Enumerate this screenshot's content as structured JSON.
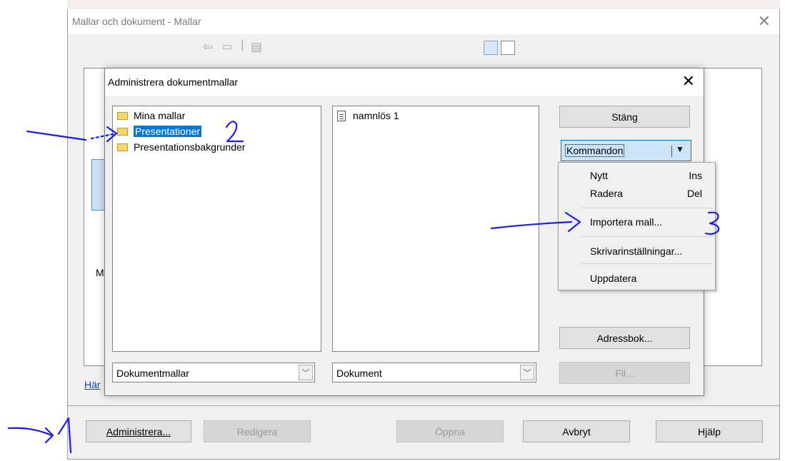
{
  "outer_window": {
    "title": "Mallar och dokument - Mallar",
    "link_text": "Här",
    "left_letter_m": "M",
    "buttons": {
      "administrera": "Administrera...",
      "redigera": "Redigera",
      "oppna": "Öppna",
      "avbryt": "Avbryt",
      "hjalp": "Hjälp"
    }
  },
  "dialog": {
    "title": "Administrera dokumentmallar",
    "left_list": [
      {
        "label": "Mina mallar",
        "selected": false
      },
      {
        "label": "Presentationer",
        "selected": true
      },
      {
        "label": "Presentationsbakgrunder",
        "selected": false
      }
    ],
    "right_list": [
      {
        "label": "namnlös 1"
      }
    ],
    "left_combo": "Dokumentmallar",
    "right_combo": "Dokument",
    "buttons": {
      "stang": "Stäng",
      "kommandon": "Kommandon",
      "adressbok": "Adressbok...",
      "fil": "Fil..."
    }
  },
  "menu": {
    "items": [
      {
        "label": "Nytt",
        "shortcut": "Ins"
      },
      {
        "label": "Radera",
        "shortcut": "Del"
      },
      {
        "label": "Importera mall...",
        "shortcut": ""
      },
      {
        "label": "Skrivarinställningar...",
        "shortcut": ""
      },
      {
        "label": "Uppdatera",
        "shortcut": ""
      }
    ]
  },
  "colors": {
    "selection": "#0078d7",
    "annotation": "#1a1aff"
  }
}
